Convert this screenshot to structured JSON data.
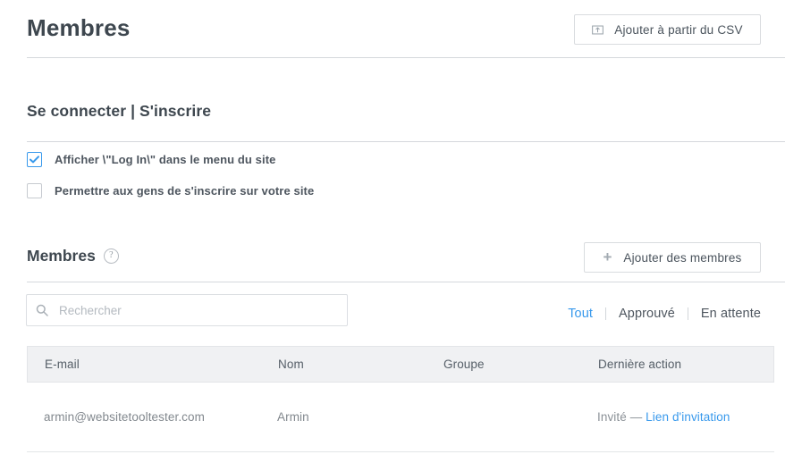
{
  "header": {
    "title": "Membres",
    "csv_button": {
      "label": "Ajouter à partir du CSV",
      "icon": "import-icon"
    }
  },
  "login_section": {
    "title": "Se connecter | S'inscrire",
    "checkboxes": [
      {
        "label": "Afficher \\\"Log In\\\" dans le menu du site",
        "checked": true
      },
      {
        "label": "Permettre aux gens de s'inscrire sur votre site",
        "checked": false
      }
    ]
  },
  "members_section": {
    "title": "Membres",
    "help_icon": "?",
    "add_button": {
      "label": "Ajouter des membres",
      "icon": "plus-icon"
    },
    "search": {
      "placeholder": "Rechercher",
      "value": "",
      "icon": "search-icon"
    },
    "filters": [
      {
        "label": "Tout",
        "active": true
      },
      {
        "label": "Approuvé",
        "active": false
      },
      {
        "label": "En attente",
        "active": false
      }
    ],
    "table": {
      "columns": [
        "E-mail",
        "Nom",
        "Groupe",
        "Dernière action"
      ],
      "rows": [
        {
          "email": "armin@websitetooltester.com",
          "name": "Armin",
          "group": "",
          "action_prefix": "Invité — ",
          "action_link": "Lien d'invitation"
        }
      ]
    }
  },
  "colors": {
    "accent": "#3899ec",
    "text": "#40474f",
    "muted": "#82888e",
    "border": "#d5d8dc",
    "table_header_bg": "#f0f1f3"
  }
}
